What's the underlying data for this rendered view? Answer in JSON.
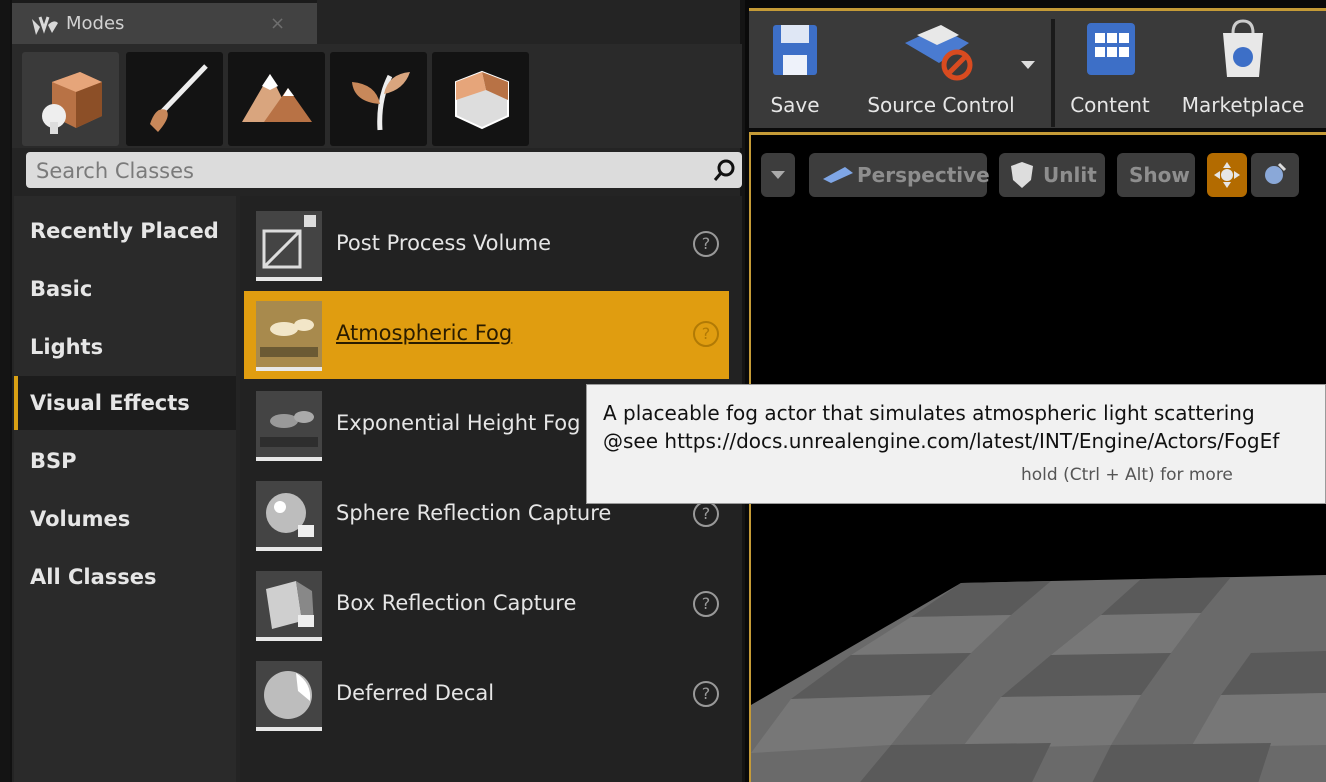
{
  "panel": {
    "tab_title": "Modes",
    "tab_close": "×",
    "mode_tabs": [
      "place-mode-icon",
      "paint-mode-icon",
      "landscape-mode-icon",
      "foliage-mode-icon",
      "geometry-mode-icon"
    ],
    "search": {
      "placeholder": "Search Classes"
    },
    "categories": [
      {
        "label": "Recently Placed"
      },
      {
        "label": "Basic"
      },
      {
        "label": "Lights"
      },
      {
        "label": "Visual Effects"
      },
      {
        "label": "BSP"
      },
      {
        "label": "Volumes"
      },
      {
        "label": "All Classes"
      }
    ],
    "selected_category": "Visual Effects",
    "items": [
      {
        "name": "Post Process Volume",
        "help": "?"
      },
      {
        "name": "Atmospheric Fog",
        "help": "?"
      },
      {
        "name": "Exponential Height Fog",
        "help": "?"
      },
      {
        "name": "Sphere Reflection Capture",
        "help": "?"
      },
      {
        "name": "Box Reflection Capture",
        "help": "?"
      },
      {
        "name": "Deferred Decal",
        "help": "?"
      }
    ],
    "selected_item": "Atmospheric Fog"
  },
  "toolbar": {
    "save": "Save",
    "source_control": "Source Control",
    "content": "Content",
    "marketplace": "Marketplace"
  },
  "viewport": {
    "perspective": "Perspective",
    "unlit": "Unlit",
    "show": "Show"
  },
  "tooltip": {
    "line1": "A placeable fog actor that simulates atmospheric light scattering",
    "line2": "@see https://docs.unrealengine.com/latest/INT/Engine/Actors/FogEf",
    "hint": "hold (Ctrl + Alt) for more"
  },
  "colors": {
    "accent": "#e09d10",
    "panel_bg": "#242424",
    "viewport_bg": "#000000"
  }
}
